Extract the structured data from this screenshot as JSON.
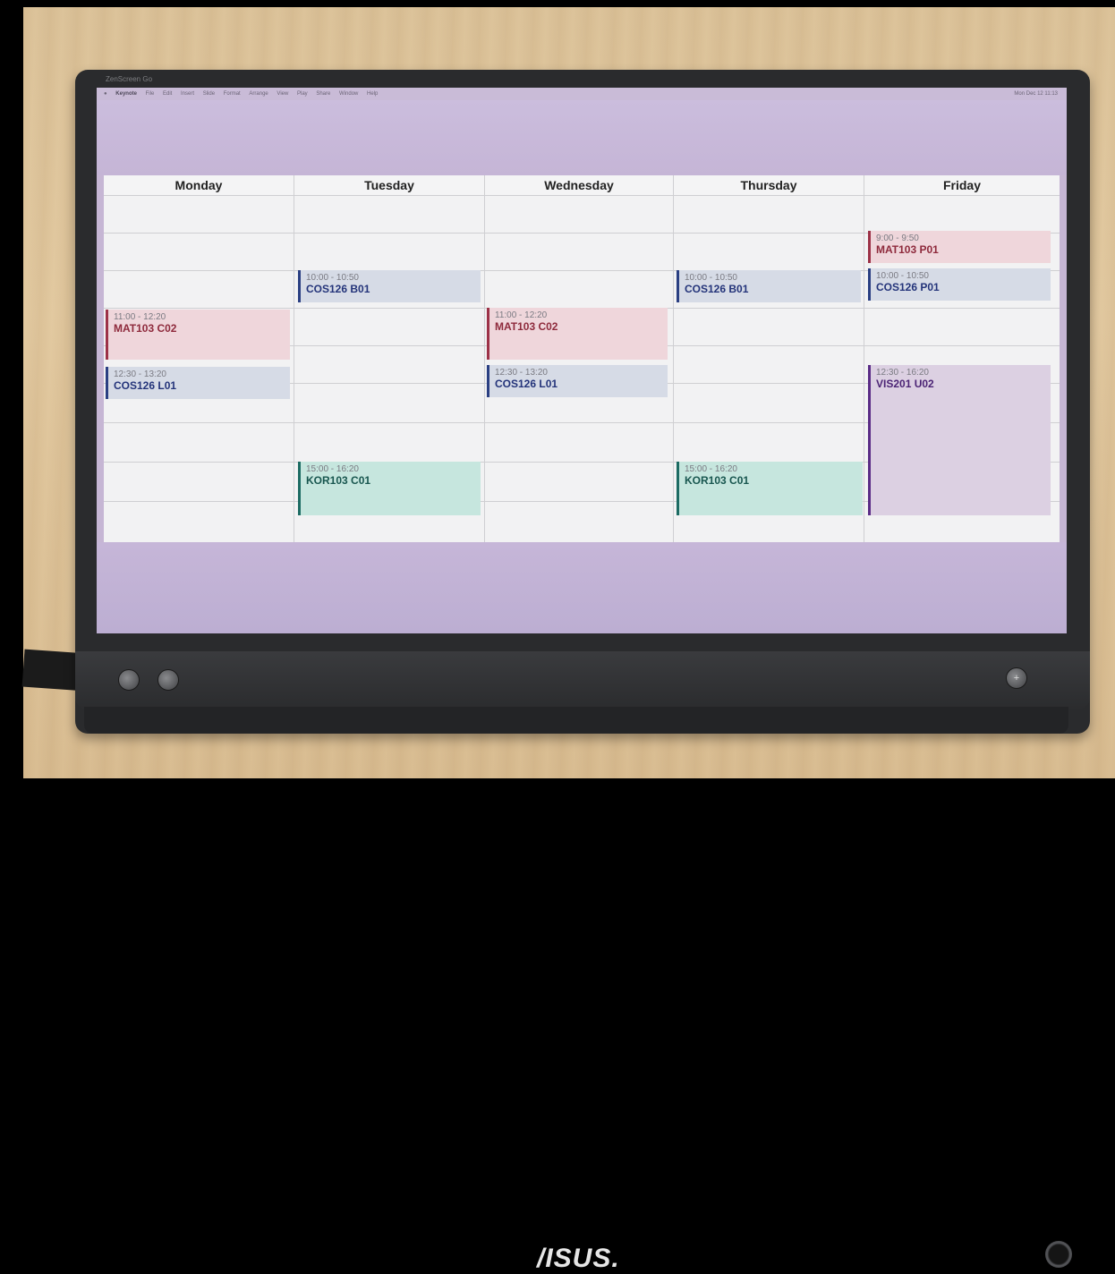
{
  "photo": {
    "monitor_label": "ZenScreen Go",
    "brand_logo": "/ISUS."
  },
  "menubar": {
    "items": [
      "Keynote",
      "File",
      "Edit",
      "Insert",
      "Slide",
      "Format",
      "Arrange",
      "View",
      "Play",
      "Share",
      "Window",
      "Help"
    ],
    "clock": "Mon Dec 12 11:13"
  },
  "timetable": {
    "days": [
      "Monday",
      "Tuesday",
      "Wednesday",
      "Thursday",
      "Friday"
    ],
    "events": {
      "monday": [
        {
          "time": "11:00 - 12:20",
          "name": "MAT103 C02"
        },
        {
          "time": "12:30 - 13:20",
          "name": "COS126 L01"
        }
      ],
      "tuesday": [
        {
          "time": "10:00 - 10:50",
          "name": "COS126 B01"
        },
        {
          "time": "15:00 - 16:20",
          "name": "KOR103 C01"
        }
      ],
      "wednesday": [
        {
          "time": "11:00 - 12:20",
          "name": "MAT103 C02"
        },
        {
          "time": "12:30 - 13:20",
          "name": "COS126 L01"
        }
      ],
      "thursday": [
        {
          "time": "10:00 - 10:50",
          "name": "COS126 B01"
        },
        {
          "time": "15:00 - 16:20",
          "name": "KOR103 C01"
        }
      ],
      "friday": [
        {
          "time": "9:00 - 9:50",
          "name": "MAT103 P01"
        },
        {
          "time": "10:00 - 10:50",
          "name": "COS126 P01"
        },
        {
          "time": "12:30 - 16:20",
          "name": "VIS201 U02"
        }
      ]
    }
  },
  "colors": {
    "mat": "#9c3147",
    "cos": "#2a3f82",
    "kor": "#1c6b63",
    "vis": "#5a2b86"
  }
}
